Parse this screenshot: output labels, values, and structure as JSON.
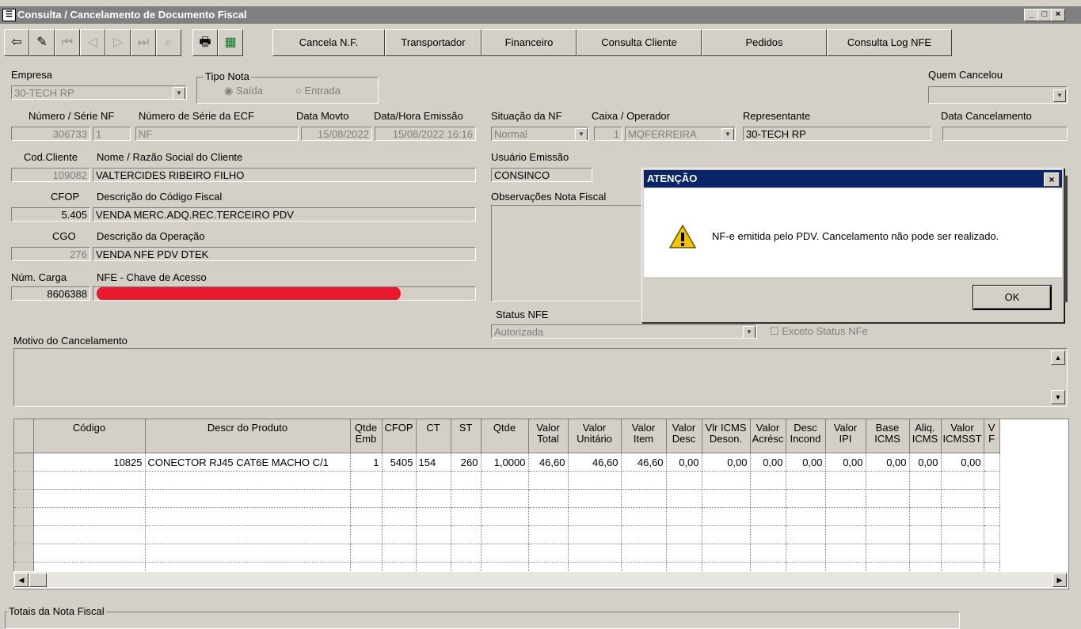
{
  "window": {
    "title": "Consulta / Cancelamento de Documento Fiscal",
    "min": "_",
    "max": "□",
    "close": "×"
  },
  "toolbar": {
    "buttons": [
      "Cancela N.F.",
      "Transportador",
      "Financeiro",
      "Consulta Cliente",
      "Pedidos",
      "Consulta Log NFE"
    ]
  },
  "form": {
    "empresa_label": "Empresa",
    "empresa_value": "30-TECH RP",
    "tipo_nota_label": "Tipo Nota",
    "saida": "Saída",
    "entrada": "Entrada",
    "quem_cancelou_label": "Quem Cancelou",
    "numero_serie_label": "Número / Série NF",
    "numero_value": "306733",
    "serie_value": "1",
    "numero_serie_ecf_label": "Número de Série da ECF",
    "numero_serie_ecf_value": "NF",
    "data_movto_label": "Data Movto",
    "data_movto_value": "15/08/2022",
    "data_emissao_label": "Data/Hora Emissão",
    "data_emissao_value": "15/08/2022 16:16",
    "situacao_label": "Situação da NF",
    "situacao_value": "Normal",
    "caixa_label": "Caixa / Operador",
    "caixa_value": "1",
    "operador_value": "MQFERREIRA",
    "representante_label": "Representante",
    "representante_value": "30-TECH RP",
    "data_cancelamento_label": "Data Cancelamento",
    "cod_cliente_label": "Cod.Cliente",
    "cod_cliente_value": "109082",
    "nome_cliente_label": "Nome / Razão Social do Cliente",
    "nome_cliente_value": "VALTERCIDES RIBEIRO FILHO",
    "usuario_emissao_label": "Usuário Emissão",
    "usuario_emissao_value": "CONSINCO",
    "cfop_label": "CFOP",
    "cfop_value": "5.405",
    "descricao_cfop_label": "Descrição do Código Fiscal",
    "descricao_cfop_value": "VENDA MERC.ADQ.REC.TERCEIRO PDV",
    "observacoes_label": "Observações Nota Fiscal",
    "cgo_label": "CGO",
    "cgo_value": "276",
    "descricao_operacao_label": "Descrição da Operação",
    "descricao_operacao_value": "VENDA NFE PDV DTEK",
    "num_carga_label": "Núm. Carga",
    "num_carga_value": "8606388",
    "chave_acesso_label": "NFE - Chave de Acesso",
    "status_nfe_label": "Status NFE",
    "status_nfe_value": "Autorizada",
    "exceto_status_label": "Exceto Status NFe",
    "motivo_label": "Motivo do Cancelamento",
    "totais_label": "Totais da Nota Fiscal"
  },
  "dialog": {
    "title": "ATENÇÃO",
    "message": "NF-e emitida pelo PDV. Cancelamento não pode ser realizado.",
    "ok": "OK",
    "close": "×"
  },
  "grid": {
    "headers": [
      "Código",
      "Descr do Produto",
      "Qtde Emb",
      "CFOP",
      "CT",
      "ST",
      "Qtde",
      "Valor Total",
      "Valor Unitário",
      "Valor Item",
      "Valor Desc",
      "Vlr ICMS Deson.",
      "Valor Acrésc",
      "Desc Incond",
      "Valor IPI",
      "Base ICMS",
      "Aliq. ICMS",
      "Valor ICMSST",
      "V F"
    ],
    "row": [
      "10825",
      "CONECTOR RJ45 CAT6E MACHO C/1",
      "1",
      "5405",
      "154",
      "260",
      "1,0000",
      "46,60",
      "46,60",
      "46,60",
      "0,00",
      "0,00",
      "0,00",
      "0,00",
      "0,00",
      "0,00",
      "0,00",
      "0,00",
      ""
    ]
  },
  "colors": {
    "dialog_title": "#0a246a",
    "redaction": "#e8192c",
    "window_bg": "#d4d0c8"
  }
}
